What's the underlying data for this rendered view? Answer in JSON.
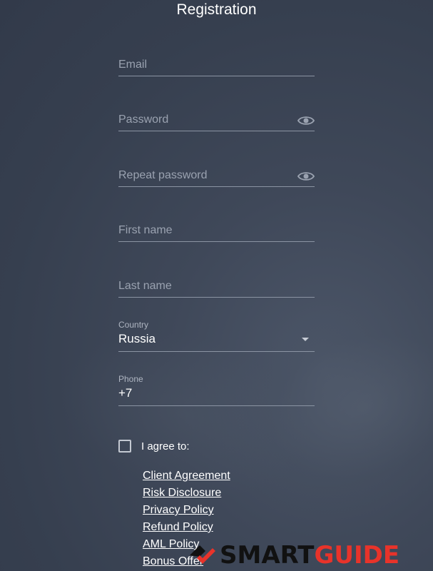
{
  "title": "Registration",
  "fields": {
    "email": {
      "placeholder": "Email"
    },
    "password": {
      "placeholder": "Password"
    },
    "repeat_password": {
      "placeholder": "Repeat password"
    },
    "first_name": {
      "placeholder": "First name"
    },
    "last_name": {
      "placeholder": "Last name"
    },
    "country": {
      "label": "Country",
      "value": "Russia"
    },
    "phone": {
      "label": "Phone",
      "value": "+7"
    }
  },
  "agreement": {
    "label": "I agree to:",
    "checked": false,
    "links": [
      "Client Agreement",
      "Risk Disclosure",
      "Privacy Policy",
      "Refund Policy",
      "AML Policy",
      "Bonus Offer"
    ]
  },
  "watermark": {
    "part1": "SMART",
    "part2": "GUIDE"
  },
  "colors": {
    "accent": "#e8332a",
    "background": "#3a4253",
    "field_line": "#8b94a3"
  }
}
